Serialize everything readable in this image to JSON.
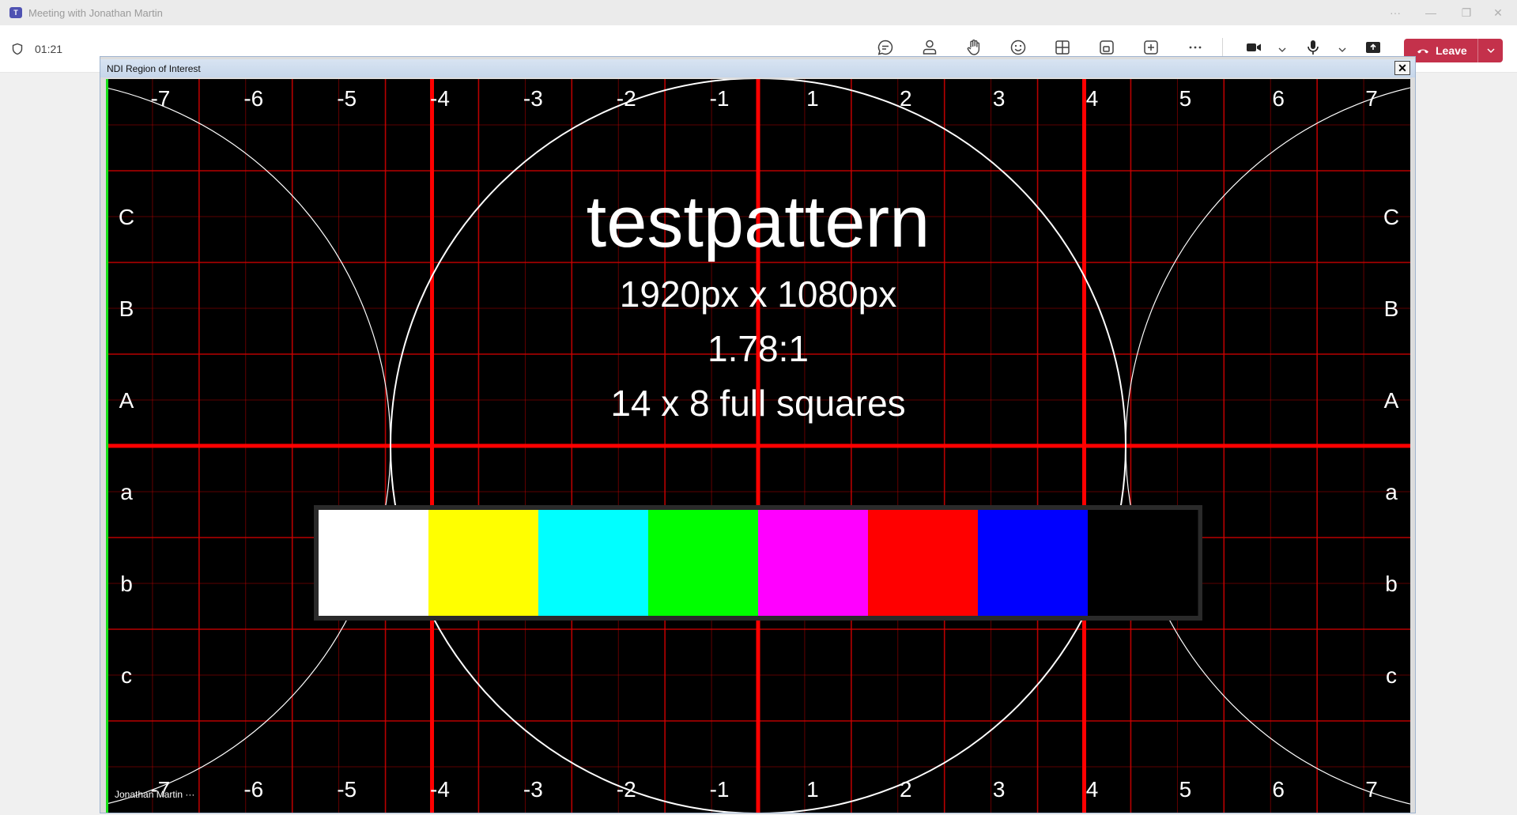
{
  "window": {
    "title": "Meeting with Jonathan Martin",
    "app_icon": "teams-icon"
  },
  "toolbar": {
    "timer": "01:21",
    "buttons": [
      {
        "name": "chat-button",
        "icon": "chat-icon"
      },
      {
        "name": "people-button",
        "icon": "people-icon"
      },
      {
        "name": "raise-hand-button",
        "icon": "hand-icon"
      },
      {
        "name": "reactions-button",
        "icon": "emoji-icon"
      },
      {
        "name": "view-button",
        "icon": "grid-icon"
      },
      {
        "name": "rooms-button",
        "icon": "rooms-icon"
      },
      {
        "name": "apps-button",
        "icon": "plus-square-icon"
      },
      {
        "name": "more-button",
        "icon": "more-icon"
      },
      {
        "name": "camera-button",
        "icon": "camera-icon"
      },
      {
        "name": "mic-button",
        "icon": "mic-icon"
      },
      {
        "name": "share-button",
        "icon": "share-icon"
      }
    ],
    "leave_label": "Leave",
    "leave_color": "#c4314b"
  },
  "ndi": {
    "title": "NDI Region of Interest",
    "close_glyph": "✕"
  },
  "pattern": {
    "title": "testpattern",
    "resolution": "1920px x 1080px",
    "aspect": "1.78:1",
    "squares": "14 x 8 full squares",
    "column_labels": [
      "-7",
      "-6",
      "-5",
      "-4",
      "-3",
      "-2",
      "-1",
      "1",
      "2",
      "3",
      "4",
      "5",
      "6",
      "7"
    ],
    "row_labels_upper": [
      "C",
      "B",
      "A"
    ],
    "row_labels_lower": [
      "a",
      "b",
      "c"
    ],
    "color_bars": [
      "#ffffff",
      "#ffff00",
      "#00ffff",
      "#00ff00",
      "#ff00ff",
      "#ff0000",
      "#0000ff",
      "#000000"
    ],
    "grid_color": "#cc0000"
  },
  "participant": {
    "name": "Jonathan Martin",
    "more": "···"
  }
}
